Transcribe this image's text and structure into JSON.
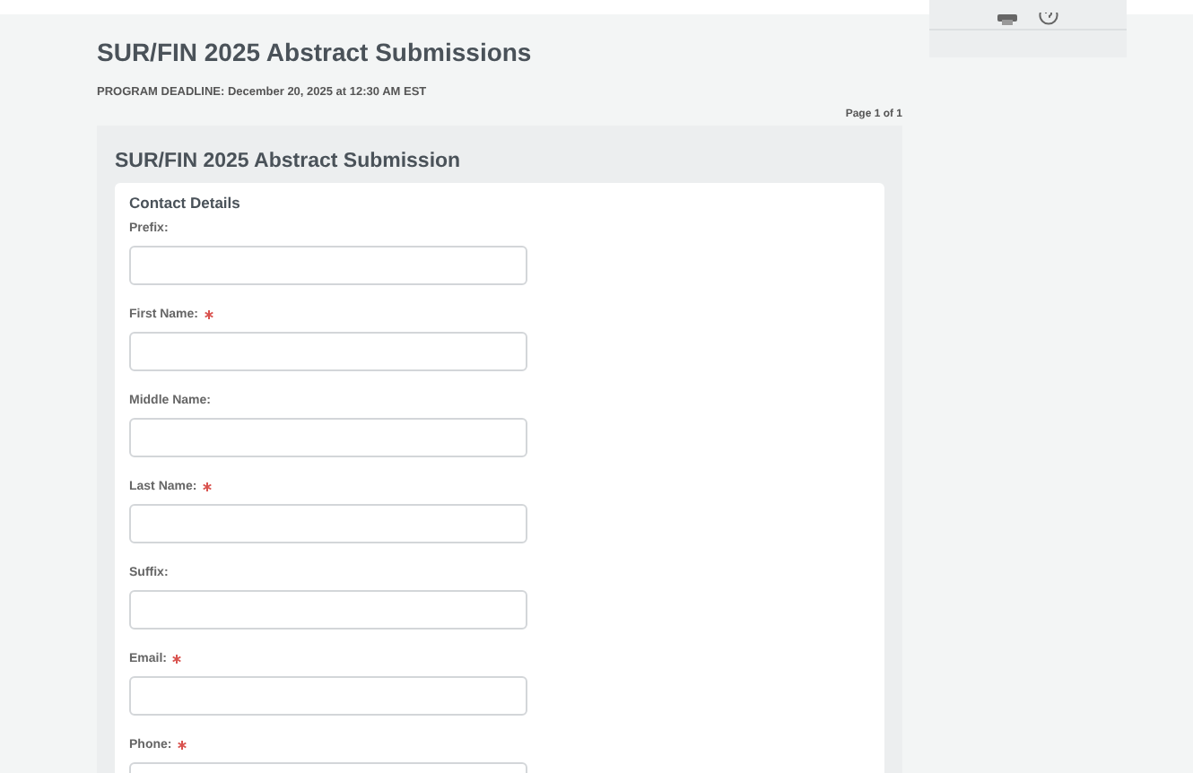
{
  "header": {
    "title": "SUR/FIN 2025 Abstract Submissions",
    "deadline_label": "PROGRAM DEADLINE:",
    "deadline": "December 20, 2025 at 12:30 AM EST",
    "page_indicator": "Page 1 of 1"
  },
  "form": {
    "title": "SUR/FIN 2025 Abstract Submission",
    "section": "Contact Details",
    "fields": [
      {
        "label": "Prefix:",
        "required": false
      },
      {
        "label": "First Name:",
        "required": true
      },
      {
        "label": "Middle Name:",
        "required": false
      },
      {
        "label": "Last Name:",
        "required": true
      },
      {
        "label": "Suffix:",
        "required": false
      },
      {
        "label": "Email:",
        "required": true
      },
      {
        "label": "Phone:",
        "required": true
      }
    ]
  }
}
